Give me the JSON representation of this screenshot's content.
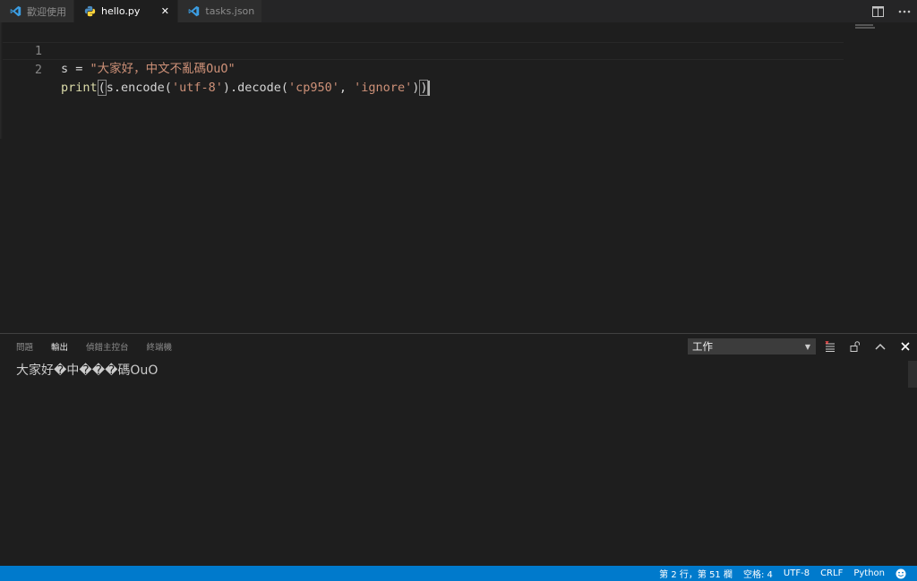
{
  "tabs": [
    {
      "label": "歡迎使用",
      "icon": "vscode-icon"
    },
    {
      "label": "hello.py",
      "icon": "python-icon"
    },
    {
      "label": "tasks.json",
      "icon": "vscode-icon"
    }
  ],
  "active_tab": "hello.py",
  "tab_close_glyph": "✕",
  "editor": {
    "line_numbers": [
      "1",
      "2"
    ],
    "line1": {
      "var": "s",
      "op": " = ",
      "str": "\"大家好，中文不亂碼OuO\""
    },
    "line2": {
      "fn": "print",
      "open": "(",
      "body1": "s.encode(",
      "arg1": "'utf-8'",
      "body2": ").decode(",
      "arg2": "'cp950'",
      "sep": ", ",
      "arg3": "'ignore'",
      "body3": ")",
      "close": ")"
    }
  },
  "panel": {
    "tabs": [
      "問題",
      "輸出",
      "偵錯主控台",
      "終端機"
    ],
    "active_tab": "輸出",
    "channel": "工作",
    "output_text": "大家好�中���碼OuO"
  },
  "status": {
    "position": "第 2 行，第 51 欄",
    "spaces": "空格: 4",
    "encoding": "UTF-8",
    "eol": "CRLF",
    "language": "Python"
  },
  "colors": {
    "accent": "#007acc",
    "string": "#ce9178",
    "function": "#dcdcaa",
    "background": "#1e1e1e"
  }
}
